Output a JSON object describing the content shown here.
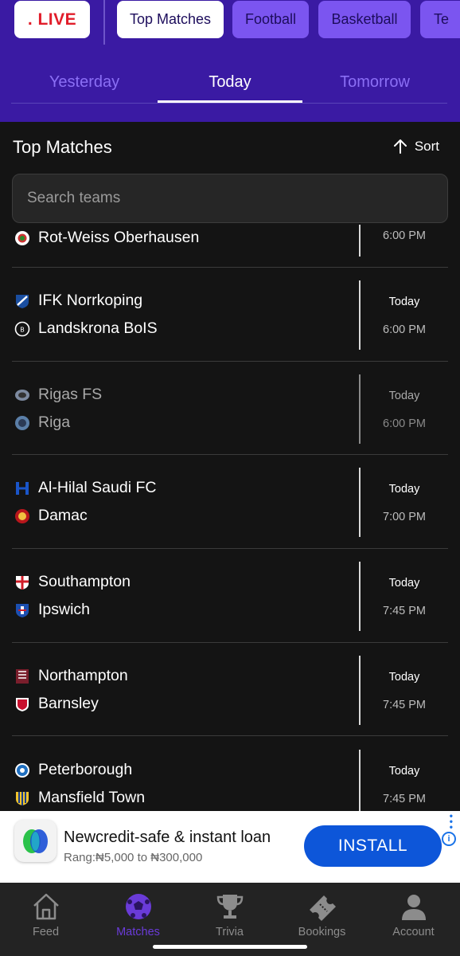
{
  "header": {
    "live_label": ". LIVE",
    "categories": [
      "Top Matches",
      "Football",
      "Basketball",
      "Te"
    ],
    "days": [
      "Yesterday",
      "Today",
      "Tomorrow"
    ]
  },
  "section": {
    "title": "Top Matches",
    "sort_label": "Sort",
    "search_placeholder": "Search teams"
  },
  "matches": [
    {
      "home": "Rot-Weiss Oberhausen",
      "away": "",
      "day": "",
      "time": "6:00 PM",
      "dim": false,
      "partial": true
    },
    {
      "home": "IFK Norrkoping",
      "away": "Landskrona BoIS",
      "day": "Today",
      "time": "6:00 PM",
      "dim": false
    },
    {
      "home": "Rigas FS",
      "away": "Riga",
      "day": "Today",
      "time": "6:00 PM",
      "dim": true
    },
    {
      "home": "Al-Hilal Saudi FC",
      "away": "Damac",
      "day": "Today",
      "time": "7:00 PM",
      "dim": false
    },
    {
      "home": "Southampton",
      "away": "Ipswich",
      "day": "Today",
      "time": "7:45 PM",
      "dim": false
    },
    {
      "home": "Northampton",
      "away": "Barnsley",
      "day": "Today",
      "time": "7:45 PM",
      "dim": false
    },
    {
      "home": "Peterborough",
      "away": "Mansfield Town",
      "day": "Today",
      "time": "7:45 PM",
      "dim": false
    }
  ],
  "ad": {
    "title": "Newcredit-safe & instant loan",
    "subtitle": "Rang:₦5,000 to ₦300,000",
    "button": "INSTALL",
    "info": "i"
  },
  "nav": {
    "items": [
      {
        "label": "Feed",
        "icon": "home-icon"
      },
      {
        "label": "Matches",
        "icon": "soccer-ball-icon"
      },
      {
        "label": "Trivia",
        "icon": "trophy-icon"
      },
      {
        "label": "Bookings",
        "icon": "ticket-icon"
      },
      {
        "label": "Account",
        "icon": "person-icon"
      }
    ],
    "active": "Matches"
  },
  "colors": {
    "header_bg": "#3a1aa3",
    "accent": "#7b55f0",
    "live_red": "#e11d2a",
    "install_blue": "#0d56d9"
  }
}
